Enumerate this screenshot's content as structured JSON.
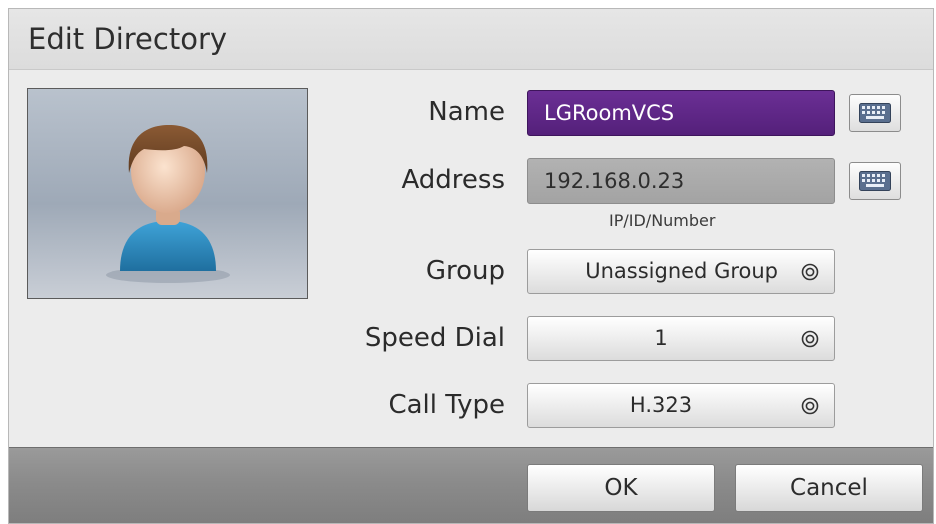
{
  "dialog": {
    "title": "Edit Directory"
  },
  "form": {
    "name": {
      "label": "Name",
      "value": "LGRoomVCS"
    },
    "address": {
      "label": "Address",
      "value": "192.168.0.23",
      "hint": "IP/ID/Number"
    },
    "group": {
      "label": "Group",
      "value": "Unassigned Group"
    },
    "speed_dial": {
      "label": "Speed Dial",
      "value": "1"
    },
    "call_type": {
      "label": "Call Type",
      "value": "H.323"
    }
  },
  "footer": {
    "ok_label": "OK",
    "cancel_label": "Cancel"
  },
  "icons": {
    "contact_photo": "person-avatar-icon",
    "keyboard": "keyboard-icon",
    "select": "dial-select-icon"
  },
  "colors": {
    "name_field": "#5f2788",
    "address_field": "#aaaaaa",
    "title_bar": "#e2e2e2",
    "footer_bar": "#8c8c8c"
  }
}
